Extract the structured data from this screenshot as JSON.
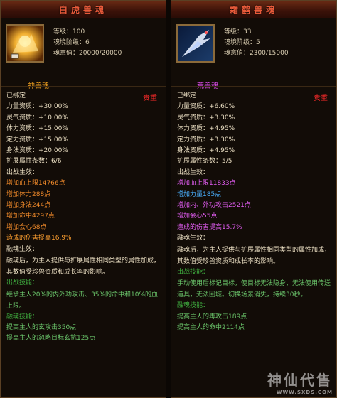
{
  "left": {
    "title": "白虎兽魂",
    "level": "等级：100",
    "realm": "魂境阶级：6",
    "soul": "魂意值：20000/20000",
    "type": "神兽魂",
    "rarity": "贵重",
    "lines": [
      {
        "t": "已绑定",
        "c": "white"
      },
      {
        "t": "力量资质：+30.00%",
        "c": "white"
      },
      {
        "t": "灵气资质：+10.00%",
        "c": "white"
      },
      {
        "t": "体力资质：+15.00%",
        "c": "white"
      },
      {
        "t": "定力资质：+15.00%",
        "c": "white"
      },
      {
        "t": "身法资质：+20.00%",
        "c": "white"
      },
      {
        "t": "扩展属性条数：6/6",
        "c": "white"
      },
      {
        "t": "出战生效：",
        "c": "white"
      },
      {
        "t": "增加血上限14766点",
        "c": "orange"
      },
      {
        "t": "增加体力288点",
        "c": "orange"
      },
      {
        "t": "增加身法244点",
        "c": "orange"
      },
      {
        "t": "增加命中4297点",
        "c": "orange"
      },
      {
        "t": "增加会心68点",
        "c": "orange"
      },
      {
        "t": "造成的伤害提高16.9%",
        "c": "orange2"
      },
      {
        "t": "融魂生效：",
        "c": "white"
      },
      {
        "t": "融魂后，为主人提供与扩展属性相同类型的属性加成，其数值受珍兽资质和成长率的影响。",
        "c": "white",
        "para": true
      },
      {
        "t": "出战技能：",
        "c": "green"
      },
      {
        "t": "继承主人20%的内外功攻击、35%的命中和10%的血上限。",
        "c": "ltgreen",
        "para": true
      },
      {
        "t": "融魂技能：",
        "c": "green"
      },
      {
        "t": "提高主人的玄攻击350点",
        "c": "ltgreen"
      },
      {
        "t": "提高主人的忽略目标玄抗125点",
        "c": "ltgreen"
      }
    ]
  },
  "right": {
    "title": "霜鹤兽魂",
    "level": "等级：33",
    "realm": "魂境阶级：5",
    "soul": "魂意值：2300/15000",
    "type": "荒兽魂",
    "rarity": "贵重",
    "lines": [
      {
        "t": "已绑定",
        "c": "white"
      },
      {
        "t": "力量资质：+6.60%",
        "c": "white"
      },
      {
        "t": "灵气资质：+3.30%",
        "c": "white"
      },
      {
        "t": "体力资质：+4.95%",
        "c": "white"
      },
      {
        "t": "定力资质：+3.30%",
        "c": "white"
      },
      {
        "t": "身法资质：+4.95%",
        "c": "white"
      },
      {
        "t": "扩展属性条数：5/5",
        "c": "white"
      },
      {
        "t": "出战生效：",
        "c": "white"
      },
      {
        "t": "增加血上限11833点",
        "c": "magenta"
      },
      {
        "t": "增加力量185点",
        "c": "cyan"
      },
      {
        "t": "增加内、外功攻击2521点",
        "c": "magenta"
      },
      {
        "t": "增加会心55点",
        "c": "magenta"
      },
      {
        "t": "造成的伤害提高15.7%",
        "c": "magenta"
      },
      {
        "t": "融魂生效：",
        "c": "white"
      },
      {
        "t": "融魂后，为主人提供与扩展属性相同类型的属性加成，其数值受珍兽资质和成长率的影响。",
        "c": "white",
        "para": true
      },
      {
        "t": "出战技能：",
        "c": "green"
      },
      {
        "t": "手动使用后标记目标，使目标无法隐身，无法使用传送道具，无法回城。切换场景消失，持续30秒。",
        "c": "ltgreen",
        "para": true
      },
      {
        "t": "融魂技能：",
        "c": "green"
      },
      {
        "t": "提高主人的毒攻击189点",
        "c": "ltgreen"
      },
      {
        "t": "提高主人的命中2114点",
        "c": "ltgreen"
      }
    ]
  },
  "watermark": {
    "text": "神仙代售",
    "url": "WWW.SXDS.COM"
  },
  "colors": {
    "rarity": "#ff2a2a",
    "title": "#e85a3a",
    "type_left": "#f0a020",
    "type_right": "#d94be8"
  }
}
